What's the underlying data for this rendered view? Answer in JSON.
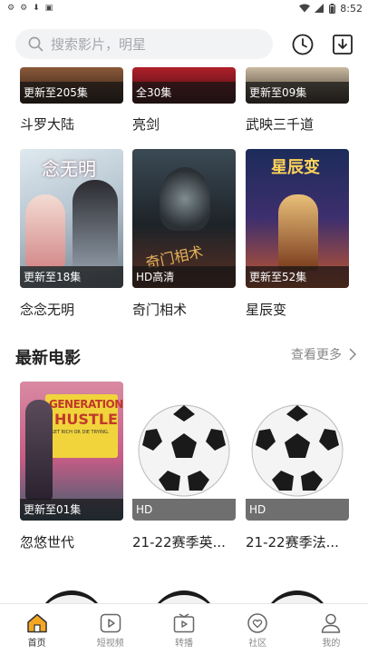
{
  "status_bar": {
    "time": "8:52"
  },
  "search": {
    "placeholder": "搜索影片，明星"
  },
  "row1": [
    {
      "title": "斗罗大陆",
      "badge": "更新至205集"
    },
    {
      "title": "亮剑",
      "badge": "全30集"
    },
    {
      "title": "武映三千道",
      "badge": "更新至09集"
    }
  ],
  "row2": [
    {
      "title": "念念无明",
      "badge": "更新至18集",
      "poster_text": "念无明"
    },
    {
      "title": "奇门相术",
      "badge": "HD高清",
      "poster_text": "奇门相术"
    },
    {
      "title": "星辰变",
      "badge": "更新至52集",
      "poster_text": "星辰变"
    }
  ],
  "section": {
    "title": "最新电影",
    "more": "查看更多"
  },
  "movies": [
    {
      "title": "忽悠世代",
      "badge": "更新至01集",
      "poster_line1": "GENERATION",
      "poster_line2": "HUSTLE",
      "poster_tag": "GET RICH OR DIE TRYING."
    },
    {
      "title": "21-22赛季英...",
      "badge": "HD"
    },
    {
      "title": "21-22赛季法...",
      "badge": "HD"
    }
  ],
  "tabs": [
    {
      "label": "首页",
      "icon": "home-icon"
    },
    {
      "label": "短视频",
      "icon": "play-icon"
    },
    {
      "label": "转播",
      "icon": "broadcast-icon"
    },
    {
      "label": "社区",
      "icon": "heart-icon"
    },
    {
      "label": "我的",
      "icon": "user-icon"
    }
  ],
  "colors": {
    "accent": "#f5a623",
    "badge_dark": "#1a1a1a",
    "badge_grey": "#6f6f6f"
  }
}
